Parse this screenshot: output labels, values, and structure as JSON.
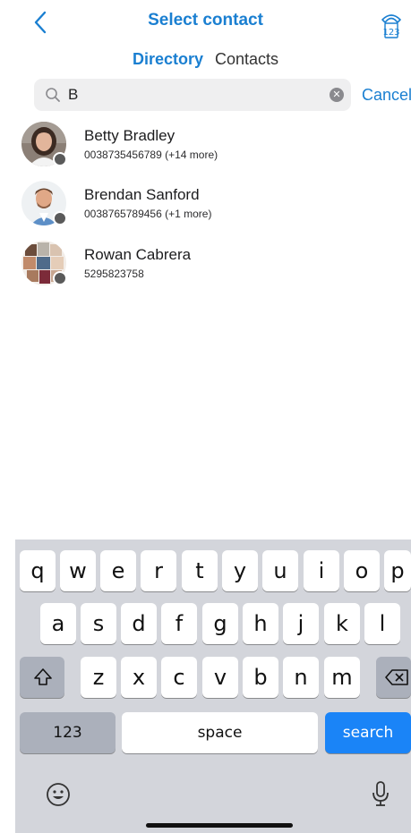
{
  "header": {
    "title": "Select contact",
    "back_icon": "chevron-left-icon",
    "dialpad_icon": "phone-keypad-icon",
    "dialpad_label": "123"
  },
  "segments": {
    "directory": "Directory",
    "contacts": "Contacts",
    "selected": "Directory"
  },
  "search": {
    "value": "B",
    "cancel_label": "Cancel"
  },
  "contacts": [
    {
      "name": "Betty Bradley",
      "number": "0038735456789 (+14 more)",
      "status": "offline"
    },
    {
      "name": "Brendan Sanford",
      "number": "0038765789456 (+1 more)",
      "status": "offline"
    },
    {
      "name": "Rowan Cabrera",
      "number": "5295823758",
      "status": "offline"
    }
  ],
  "keyboard": {
    "row1": [
      "q",
      "w",
      "e",
      "r",
      "t",
      "y",
      "u",
      "i",
      "o",
      "p"
    ],
    "row2": [
      "a",
      "s",
      "d",
      "f",
      "g",
      "h",
      "j",
      "k",
      "l"
    ],
    "row3": [
      "z",
      "x",
      "c",
      "v",
      "b",
      "n",
      "m"
    ],
    "numbers_label": "123",
    "space_label": "space",
    "search_label": "search",
    "accent_color": "#1a84f7"
  },
  "colors": {
    "accent": "#1a7fd1",
    "status_dot": "#5a5a5a"
  }
}
